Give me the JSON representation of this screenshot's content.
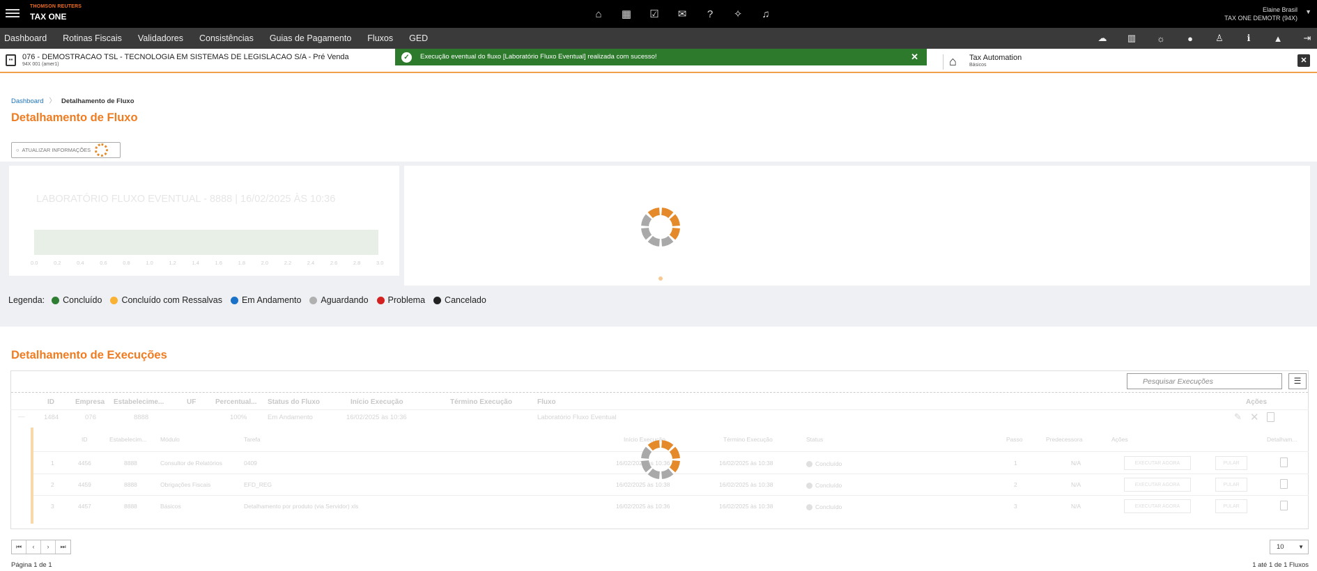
{
  "brand": {
    "company": "THOMSON REUTERS",
    "product": "TAX ONE"
  },
  "top_icons": [
    "home-icon",
    "calendar-icon",
    "checklist-icon",
    "chat-icon",
    "help-icon",
    "sparkle-icon",
    "bell-icon"
  ],
  "user": {
    "name": "Elaine Brasil",
    "org": "TAX ONE DEMOTR (94X)"
  },
  "nav": {
    "items": [
      "Dashboard",
      "Rotinas Fiscais",
      "Validadores",
      "Consistências",
      "Guias de Pagamento",
      "Fluxos",
      "GED"
    ],
    "right_icons": [
      "cloud-icon",
      "library-icon",
      "sun-icon",
      "record-icon",
      "user-icon",
      "info-icon",
      "warning-icon",
      "logout-icon"
    ]
  },
  "context": {
    "company": "076 - DEMOSTRACAO TSL - TECNOLOGIA EM SISTEMAS DE LEGISLACAO S/A - Pré Venda",
    "sub": "94X 001 (amer1)",
    "module": "Tax Automation",
    "module_sub": "Básicos"
  },
  "toast": {
    "message": "Execução eventual do fluxo [Laboratório Fluxo Eventual] realizada com sucesso!",
    "close": "✕"
  },
  "breadcrumb": {
    "root": "Dashboard",
    "current": "Detalhamento de Fluxo"
  },
  "page_title": "Detalhamento de Fluxo",
  "refresh_label": "ATUALIZAR INFORMAÇÕES",
  "chart": {
    "title": "LABORATÓRIO FLUXO EVENTUAL - 8888 | 16/02/2025 ÀS 10:36",
    "ticks": [
      "0.0",
      "0.2",
      "0.4",
      "0.6",
      "0.8",
      "1.0",
      "1.2",
      "1.4",
      "1.6",
      "1.8",
      "2.0",
      "2.2",
      "2.4",
      "2.6",
      "2.8",
      "3.0"
    ]
  },
  "legend": {
    "label": "Legenda:",
    "items": [
      {
        "label": "Concluído",
        "color": "#2e7d32"
      },
      {
        "label": "Concluído com Ressalvas",
        "color": "#f9b233"
      },
      {
        "label": "Em Andamento",
        "color": "#1a72c8"
      },
      {
        "label": "Aguardando",
        "color": "#b0b0b0"
      },
      {
        "label": "Problema",
        "color": "#d32020"
      },
      {
        "label": "Cancelado",
        "color": "#222222"
      }
    ]
  },
  "section2_title": "Detalhamento de Execuções",
  "search_placeholder": "Pesquisar Execuções",
  "table": {
    "headers": [
      "ID",
      "Empresa",
      "Estabelecime...",
      "UF",
      "Percentual...",
      "Status do Fluxo",
      "Início Execução",
      "Término Execução",
      "Fluxo",
      "Ações"
    ],
    "row": [
      "1484",
      "076",
      "8888",
      "100%",
      "Em Andamento",
      "16/02/2025 às 10:36",
      "Laboratório Fluxo Eventual"
    ],
    "sub_headers": [
      "ID",
      "Estabelecim...",
      "Módulo",
      "Tarefa",
      "Início Execução",
      "Término Execução",
      "Status",
      "Passo",
      "Predecessora",
      "Ações",
      "Detalham..."
    ],
    "sub_rows": [
      {
        "n": "1",
        "id": "4456",
        "est": "8888",
        "mod": "Consultor de Relatórios",
        "task": "0409",
        "ini": "16/02/2025 às 10:36",
        "fim": "16/02/2025 às 10:38",
        "status": "Concluído",
        "passo": "1",
        "pred": "N/A"
      },
      {
        "n": "2",
        "id": "4459",
        "est": "8888",
        "mod": "Obrigações Fiscais",
        "task": "EFD_REG",
        "ini": "16/02/2025 às 10:38",
        "fim": "16/02/2025 às 10:38",
        "status": "Concluído",
        "passo": "2",
        "pred": "N/A"
      },
      {
        "n": "3",
        "id": "4457",
        "est": "8888",
        "mod": "Básicos",
        "task": "Detalhamento por produto (via Servidor) xls",
        "ini": "16/02/2025 às 10:36",
        "fim": "16/02/2025 às 10:38",
        "status": "Concluído",
        "passo": "3",
        "pred": "N/A"
      }
    ],
    "action_exec": "EXECUTAR AGORA",
    "action_skip": "PULAR"
  },
  "pager": {
    "first": "⏮",
    "prev": "‹",
    "next": "›",
    "last": "⏭",
    "page_info": "Página 1 de 1",
    "page_size": "10",
    "range_info": "1 até 1 de 1 Fluxos"
  }
}
